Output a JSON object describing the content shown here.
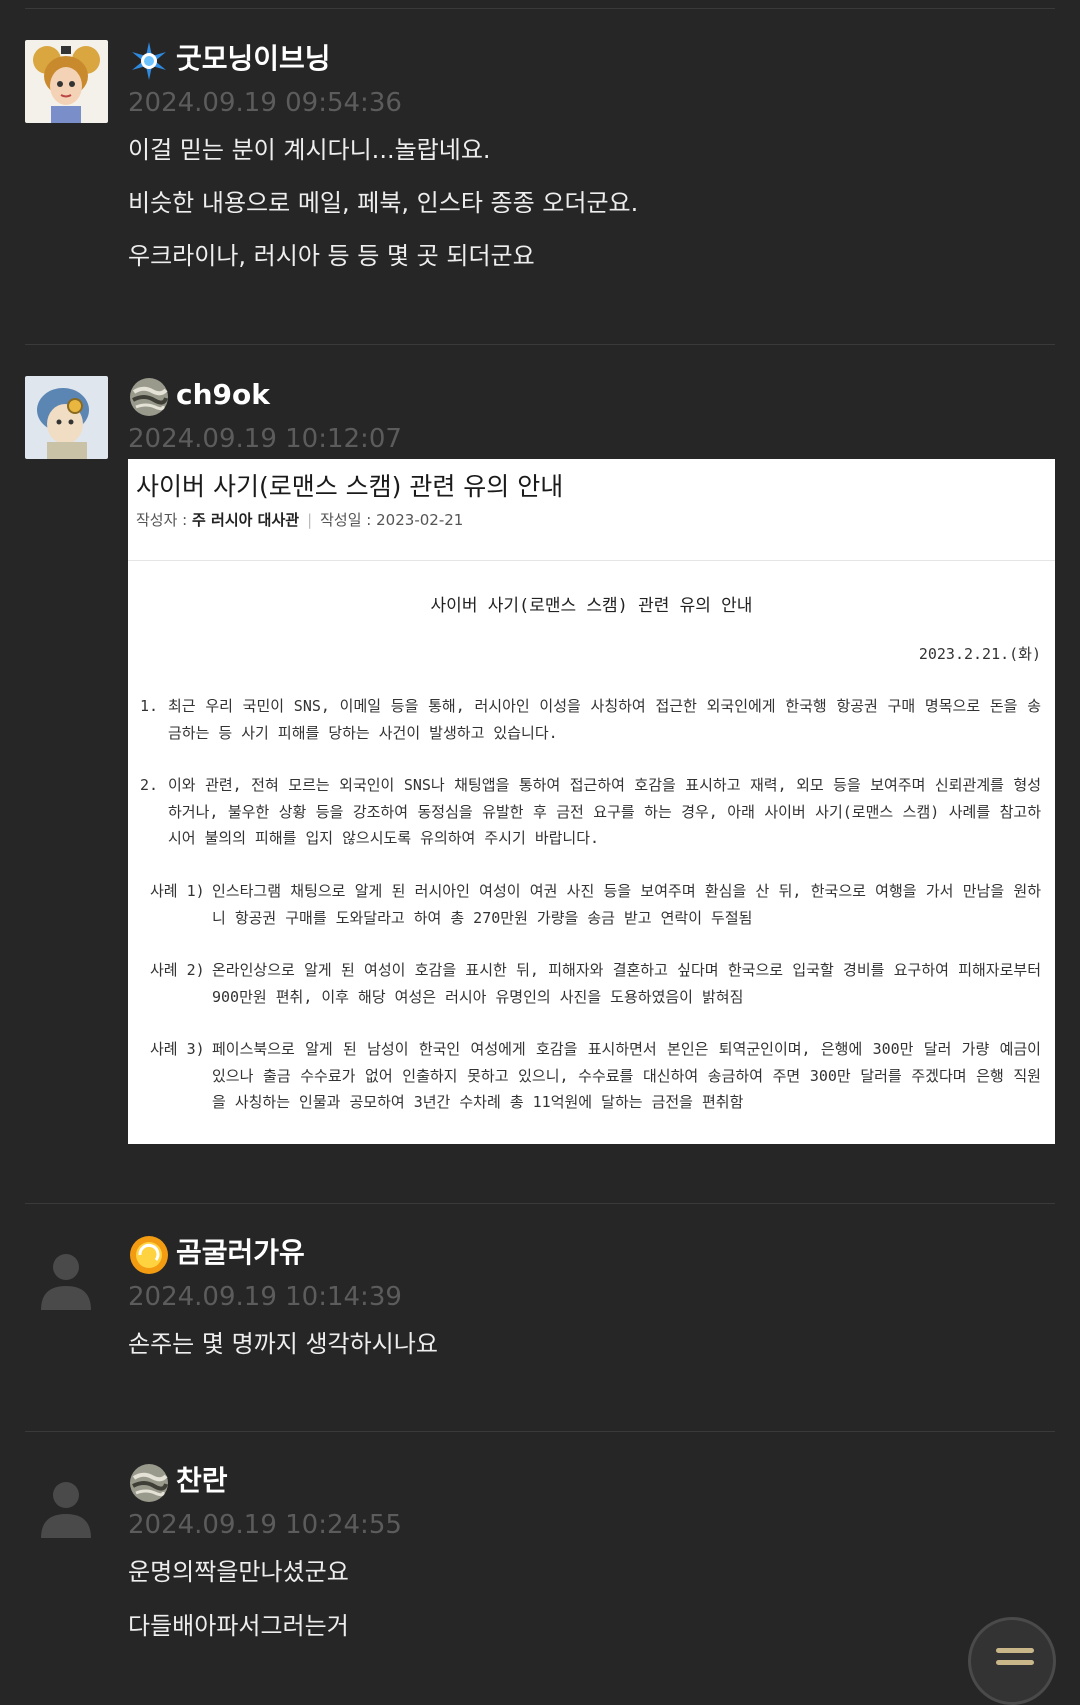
{
  "comments": [
    {
      "nickname": "굿모닝이브닝",
      "date": "2024.09.19 09:54:36",
      "level_icon": "blue-star-icon",
      "lines": [
        "이걸 믿는 분이 계시다니...놀랍네요.",
        "비슷한 내용으로 메일, 페북, 인스타 종종 오더군요.",
        "우크라이나, 러시아 등 등 몇 곳 되더군요"
      ]
    },
    {
      "nickname": "ch9ok",
      "date": "2024.09.19 10:12:07",
      "level_icon": "gray-globe-icon",
      "attachment": {
        "title": "사이버 사기(로맨스 스캠) 관련 유의 안내",
        "author_label": "작성자 :",
        "author": "주 러시아 대사관",
        "date_label": "작성일 :",
        "date": "2023-02-21",
        "heading": "사이버 사기(로맨스 스캠) 관련 유의 안내",
        "doc_date": "2023.2.21.(화)",
        "para1_num": "1.",
        "para1": "최근 우리 국민이 SNS, 이메일 등을 통해, 러시아인 이성을 사칭하여 접근한 외국인에게 한국행 항공권 구매 명목으로 돈을 송금하는 등 사기 피해를 당하는 사건이 발생하고 있습니다.",
        "para2_num": "2.",
        "para2": "이와 관련, 전혀 모르는 외국인이 SNS나 채팅앱을 통하여 접근하여 호감을 표시하고 재력, 외모 등을 보여주며 신뢰관계를 형성하거나, 불우한 상황 등을 강조하여 동정심을 유발한 후 금전 요구를 하는 경우, 아래 사이버 사기(로맨스 스캠) 사례를 참고하시어 불의의 피해를 입지 않으시도록 유의하여 주시기 바랍니다.",
        "case1_label": "사례 1)",
        "case1": "인스타그램 채팅으로 알게 된 러시아인 여성이 여권 사진 등을 보여주며 환심을 산 뒤, 한국으로 여행을 가서 만남을 원하니 항공권 구매를 도와달라고 하여 총 270만원 가량을 송금 받고 연락이 두절됨",
        "case2_label": "사례 2)",
        "case2": "온라인상으로 알게 된 여성이 호감을 표시한 뒤, 피해자와 결혼하고 싶다며 한국으로 입국할 경비를 요구하여 피해자로부터 900만원 편취, 이후 해당 여성은 러시아 유명인의 사진을 도용하였음이 밝혀짐",
        "case3_label": "사례 3)",
        "case3": "페이스북으로 알게 된 남성이 한국인 여성에게 호감을 표시하면서 본인은 퇴역군인이며, 은행에 300만 달러 가량 예금이 있으나 출금 수수료가 없어 인출하지 못하고 있으니, 수수료를 대신하여 송금하여 주면 300만 달러를 주겠다며 은행 직원을 사칭하는 인물과 공모하여 3년간 수차례 총 11억원에 달하는 금전을 편취함"
      }
    },
    {
      "nickname": "곰굴러가유",
      "date": "2024.09.19 10:14:39",
      "level_icon": "orange-sun-icon",
      "lines": [
        "손주는 몇 명까지 생각하시나요"
      ]
    },
    {
      "nickname": "찬란",
      "date": "2024.09.19 10:24:55",
      "level_icon": "gray-globe-icon",
      "lines": [
        "운명의짝을만나셨군요",
        "다들배아파서그러는거"
      ]
    }
  ],
  "colors": {
    "background": "#262626",
    "date_text": "#5c5c5c",
    "divider": "#3a3a3a"
  },
  "fab_icon": "menu-icon"
}
